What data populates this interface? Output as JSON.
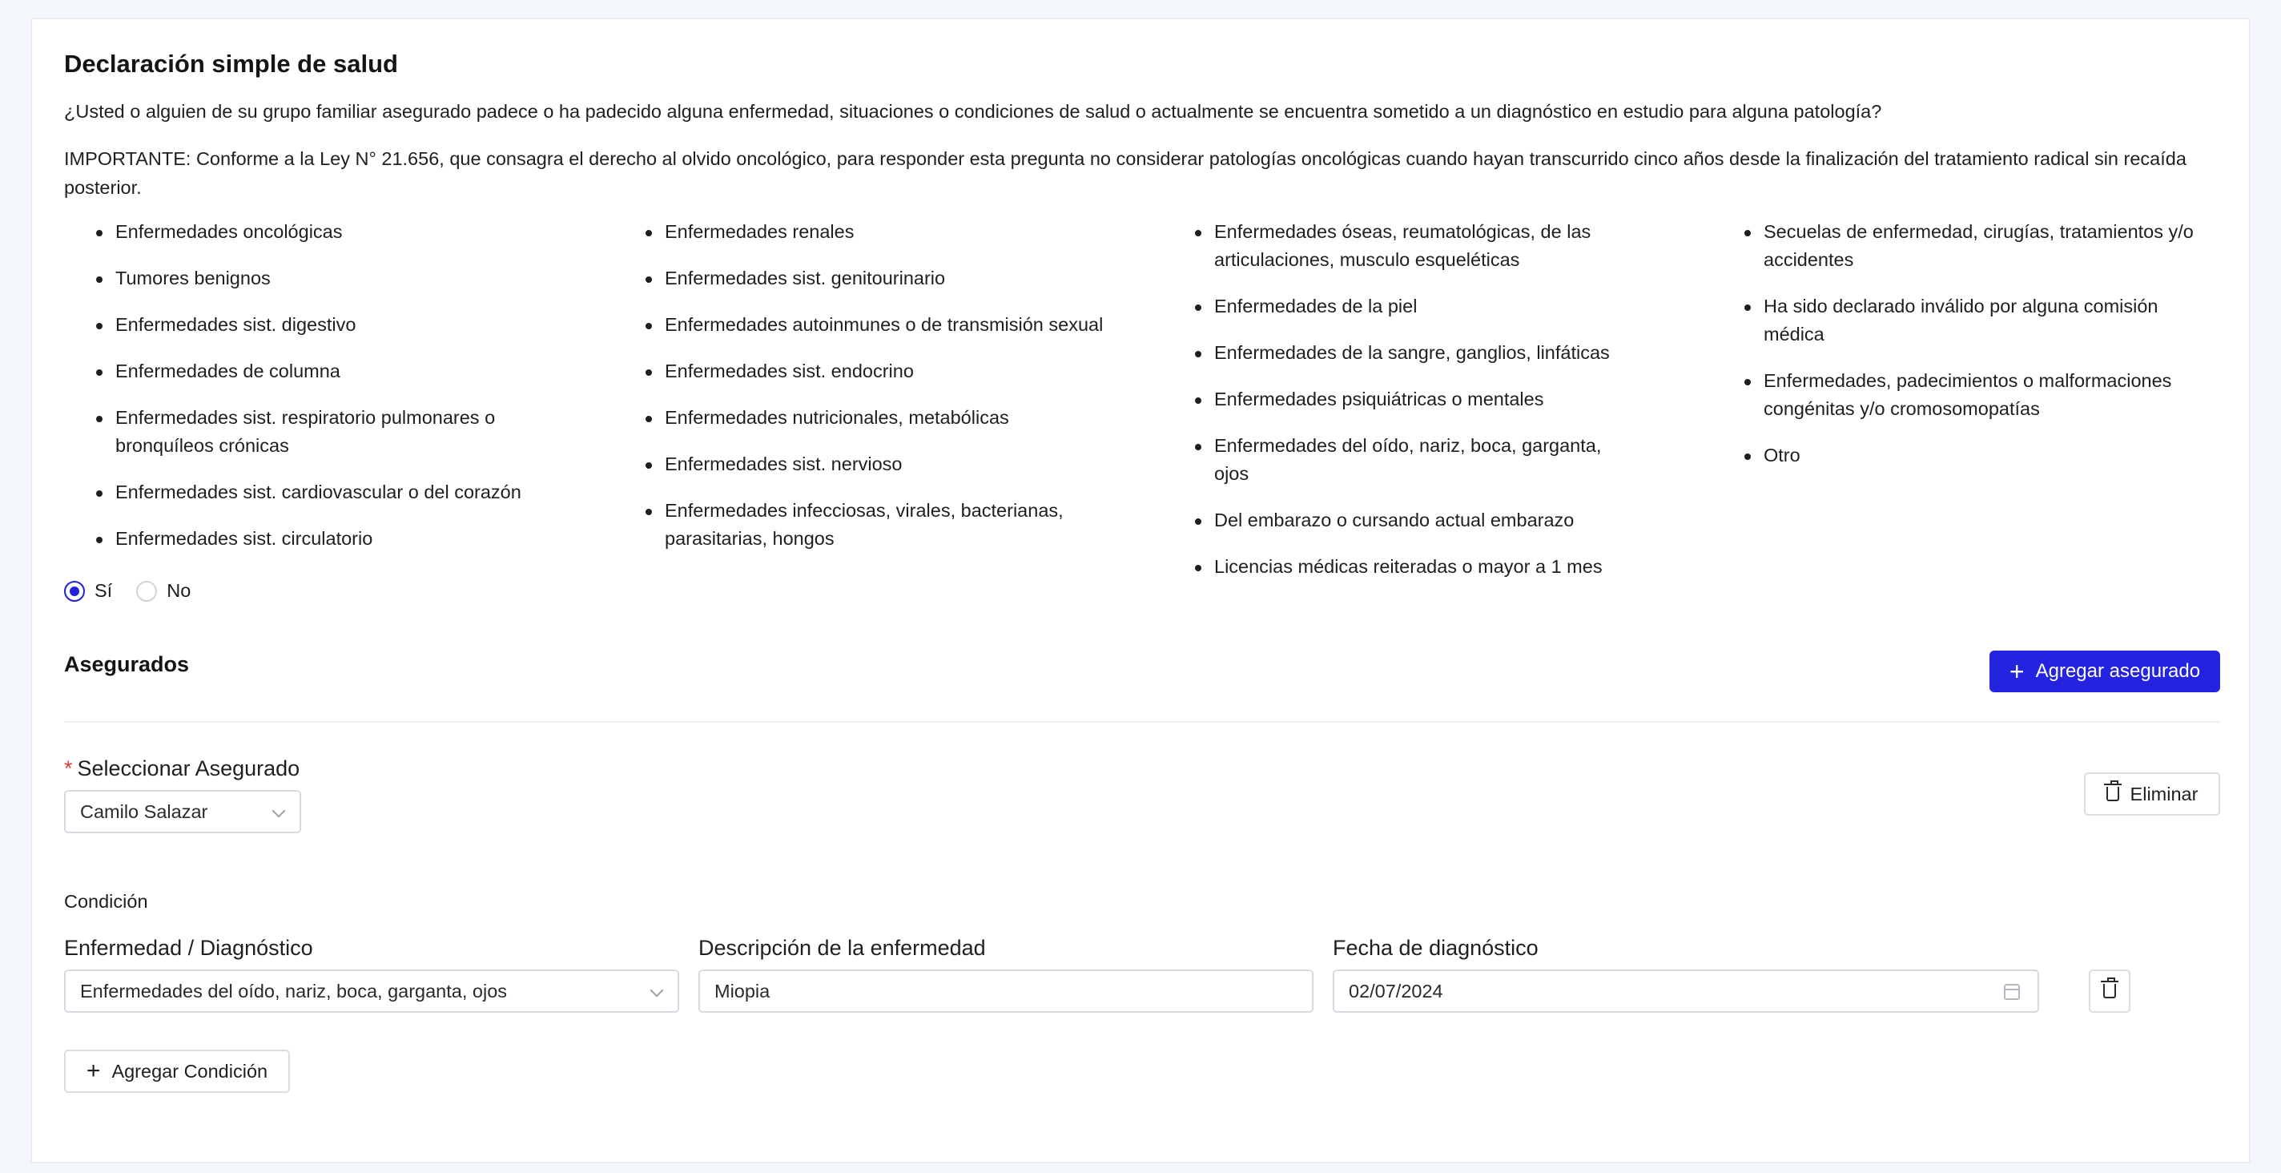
{
  "header": {
    "title": "Declaración simple de salud",
    "question": "¿Usted o alguien de su grupo familiar asegurado padece o ha padecido alguna enfermedad, situaciones o condiciones de salud o actualmente se encuentra sometido a un diagnóstico en estudio para alguna patología?",
    "important": "IMPORTANTE: Conforme a la Ley N° 21.656, que consagra el derecho al olvido oncológico, para responder esta pregunta no considerar patologías oncológicas cuando hayan transcurrido cinco años desde la finalización del tratamiento radical sin recaída posterior."
  },
  "conditions_list": {
    "col1": [
      "Enfermedades oncológicas",
      "Tumores benignos",
      "Enfermedades sist. digestivo",
      "Enfermedades de columna",
      "Enfermedades sist. respiratorio pulmonares o bronquíleos crónicas",
      "Enfermedades sist. cardiovascular o del corazón",
      "Enfermedades sist. circulatorio"
    ],
    "col2": [
      "Enfermedades renales",
      "Enfermedades sist. genitourinario",
      "Enfermedades autoinmunes o de transmisión sexual",
      "Enfermedades sist. endocrino",
      "Enfermedades nutricionales, metabólicas",
      "Enfermedades sist. nervioso",
      "Enfermedades infecciosas, virales, bacterianas, parasitarias, hongos"
    ],
    "col3": [
      "Enfermedades óseas, reumatológicas, de las articulaciones, musculo esqueléticas",
      "Enfermedades de la piel",
      "Enfermedades de la sangre, ganglios, linfáticas",
      "Enfermedades psiquiátricas o mentales",
      "Enfermedades del oído, nariz, boca, garganta, ojos",
      "Del embarazo o cursando actual embarazo",
      "Licencias médicas reiteradas o mayor a 1 mes"
    ],
    "col4": [
      "Secuelas de enfermedad, cirugías, tratamientos y/o accidentes",
      "Ha sido declarado inválido por alguna comisión médica",
      "Enfermedades, padecimientos o malformaciones congénitas y/o cromosomopatías",
      "Otro"
    ]
  },
  "answer": {
    "yes_label": "Sí",
    "no_label": "No",
    "selected": "yes"
  },
  "asegurados": {
    "title": "Asegurados",
    "add_button": "Agregar asegurado",
    "select_label": "Seleccionar Asegurado",
    "required_mark": "*",
    "selected_value": "Camilo Salazar",
    "delete_button": "Eliminar"
  },
  "condition": {
    "section_label": "Condición",
    "disease_label": "Enfermedad / Diagnóstico",
    "disease_value": "Enfermedades del oído, nariz, boca, garganta, ojos",
    "description_label": "Descripción de la enfermedad",
    "description_value": "Miopia",
    "date_label": "Fecha de diagnóstico",
    "date_value": "02/07/2024",
    "add_button": "Agregar Condición"
  },
  "colors": {
    "primary": "#2323e0",
    "required": "#e23b3b",
    "background": "#f3f6fa"
  },
  "icons": {
    "add": "plus-icon",
    "delete": "trash-icon",
    "select": "chevron-down-icon",
    "date": "calendar-icon"
  }
}
